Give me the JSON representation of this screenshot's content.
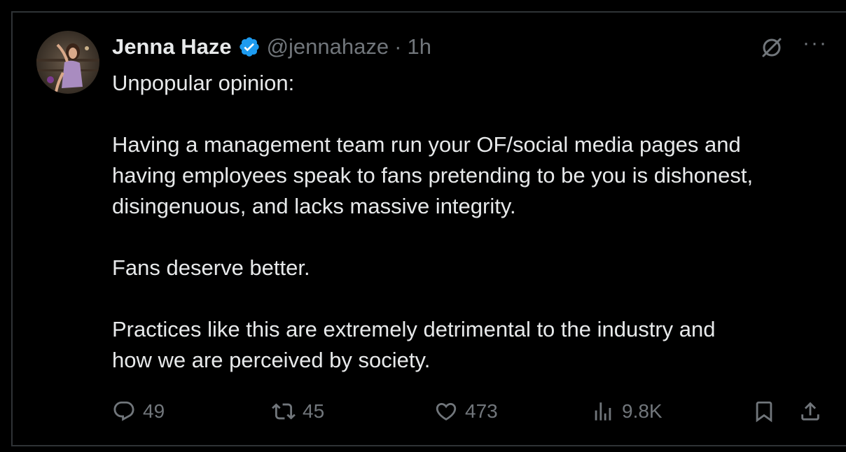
{
  "tweet": {
    "author": {
      "name": "Jenna Haze",
      "handle": "@jennahaze",
      "separator": "·",
      "time": "1h",
      "verified": true
    },
    "text": {
      "line1": "Unpopular opinion:",
      "line2": "Having a management team run your OF/social media pages and",
      "line3": "having employees speak to fans pretending to be you is dishonest,",
      "line4": "disingenuous, and lacks massive integrity.",
      "line5": "Fans deserve better.",
      "line6": "Practices like this are extremely detrimental to the industry and",
      "line7": "how we are perceived by society."
    },
    "stats": {
      "replies": "49",
      "reposts": "45",
      "likes": "473",
      "views": "9.8K"
    },
    "icons": [
      "grok-icon",
      "more-icon",
      "reply-icon",
      "repost-icon",
      "like-icon",
      "views-icon",
      "bookmark-icon",
      "share-icon",
      "verified-badge-icon"
    ],
    "colors": {
      "background": "#000000",
      "text": "#e7e9ea",
      "muted": "#71767b",
      "verified": "#1d9bf0",
      "border": "#2f3336"
    }
  }
}
